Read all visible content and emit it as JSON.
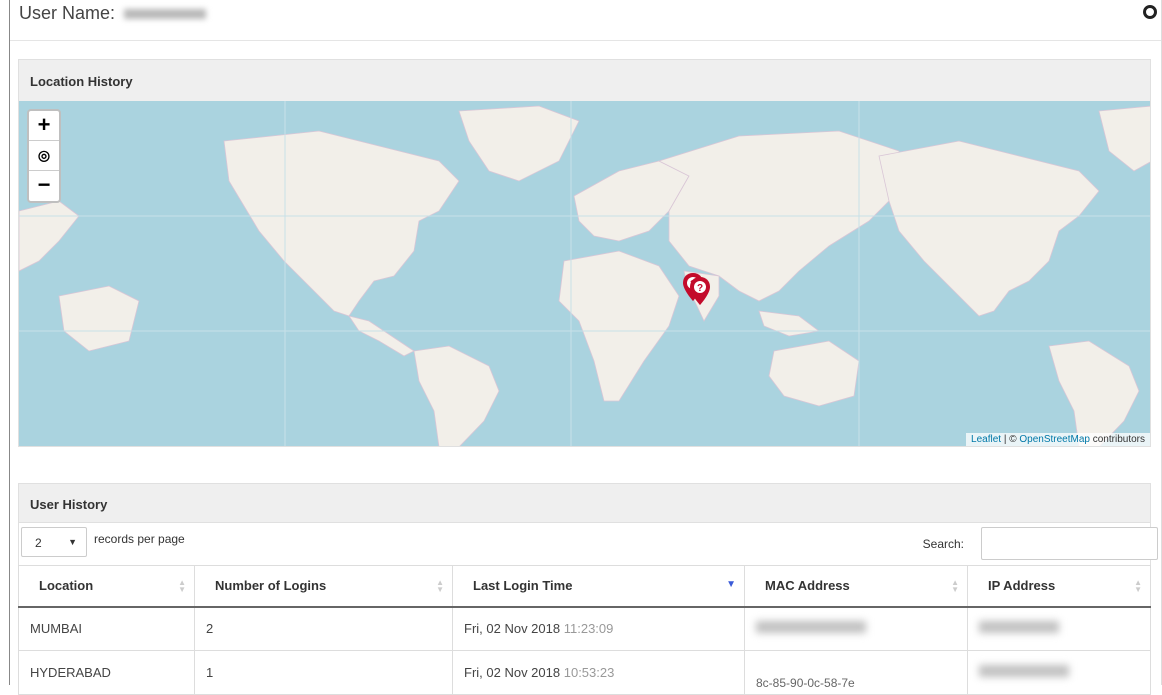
{
  "header": {
    "user_label": "User Name:"
  },
  "location_history": {
    "title": "Location History",
    "zoom_in": "+",
    "zoom_globe": "◎",
    "zoom_out": "−",
    "attribution_leaflet": "Leaflet",
    "attribution_sep": " | © ",
    "attribution_osm": "OpenStreetMap",
    "attribution_suffix": " contributors",
    "marker_1_icon": "?",
    "marker_2_icon": "?"
  },
  "user_history": {
    "title": "User History",
    "per_page_value": "2",
    "per_page_label": "records per page",
    "search_label": "Search:",
    "columns": [
      "Location",
      "Number of Logins",
      "Last Login Time",
      "MAC Address",
      "IP Address"
    ],
    "rows": [
      {
        "location": "MUMBAI",
        "logins": "2",
        "date": "Fri, 02 Nov 2018",
        "time": "11:23:09",
        "mac": "",
        "ip": ""
      },
      {
        "location": "HYDERABAD",
        "logins": "1",
        "date": "Fri, 02 Nov 2018",
        "time": "10:53:23",
        "mac": "8c-85-90-0c-58-7e",
        "ip": ""
      }
    ]
  },
  "colors": {
    "ocean": "#aad3df",
    "land": "#f2efe9",
    "marker": "#c30b2b",
    "sort_active": "#3a5bd8"
  }
}
